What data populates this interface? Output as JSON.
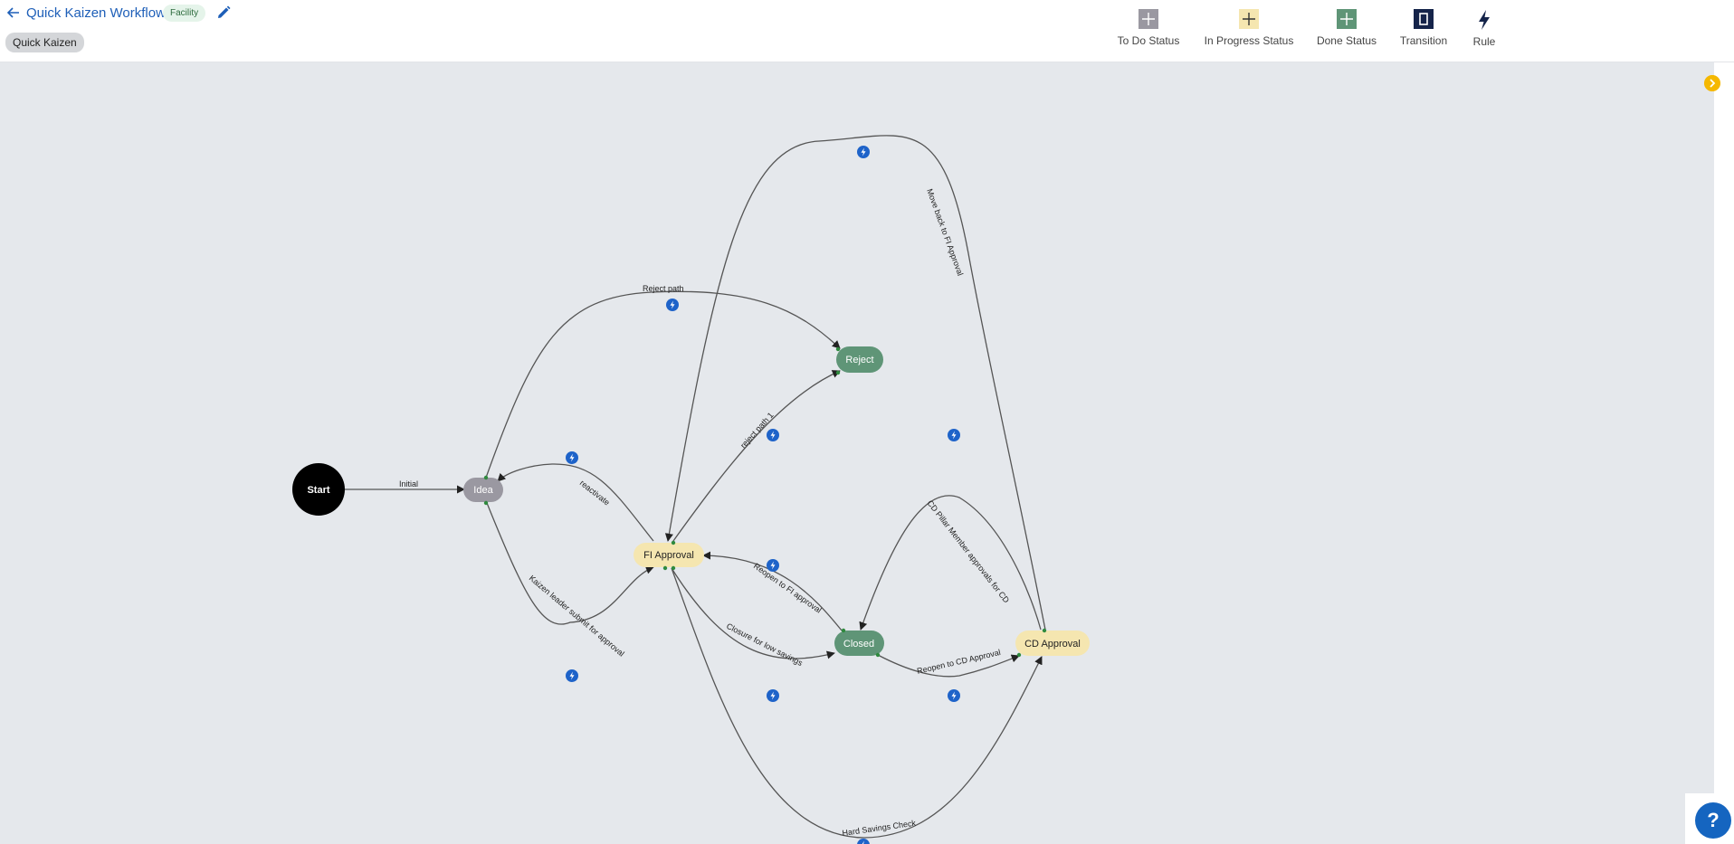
{
  "header": {
    "title": "Quick Kaizen Workflow",
    "badge": "Facility",
    "tab": "Quick Kaizen"
  },
  "toolbar": {
    "todo_label": "To Do Status",
    "inprogress_label": "In Progress Status",
    "done_label": "Done Status",
    "transition_label": "Transition",
    "rule_label": "Rule"
  },
  "nodes": {
    "start": "Start",
    "idea": "Idea",
    "fi_approval": "FI Approval",
    "reject": "Reject",
    "closed": "Closed",
    "cd_approval": "CD Approval"
  },
  "edges": {
    "initial": "Initial",
    "reject_path": "Reject path",
    "reactivate": "reactivate",
    "reject_path_1": "reject path 1",
    "kaizen_submit": "Kaizen leader submit for approval",
    "reopen_fi": "Reopen to FI approval",
    "closure_low": "Closure for low savings",
    "reopen_cd": "Reopen to CD Approval",
    "cd_pillar": "CD Pillar Member approvals for CD",
    "move_back": "Move back to FI Approval",
    "hard_savings": "Hard Savings Check"
  },
  "help": {
    "label": "?"
  },
  "colors": {
    "todo": "#9a98a1",
    "inprogress": "#f5e6b0",
    "done": "#5f9577",
    "start": "#000000",
    "link": "#1e5fb8",
    "rule_badge": "#1e63c9",
    "canvas": "#e5e8ec",
    "expand": "#f5b800"
  },
  "icons": {
    "back": "arrow-left-icon",
    "edit": "pencil-icon",
    "rule": "lightning-icon",
    "expand": "chevron-right-icon"
  }
}
